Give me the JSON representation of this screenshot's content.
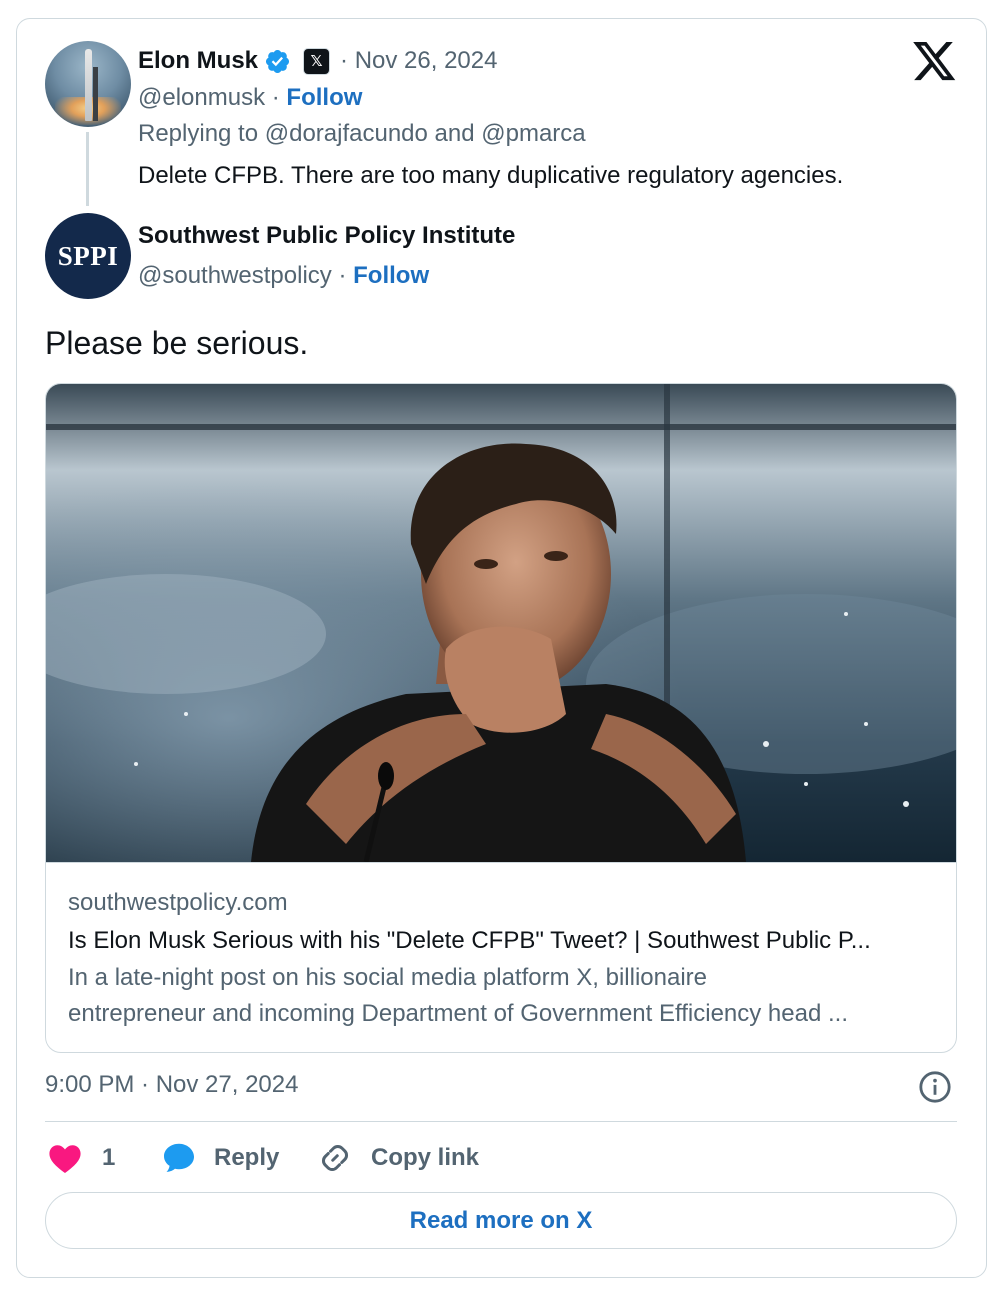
{
  "parent_tweet": {
    "author_name": "Elon Musk",
    "date": "Nov 26, 2024",
    "handle": "@elonmusk",
    "follow_label": "Follow",
    "replying_to": "Replying to @dorajfacundo and @pmarca",
    "text": "Delete CFPB. There are too many duplicative regulatory agencies.",
    "affiliate_badge": "𝕏"
  },
  "main_tweet": {
    "author_name": "Southwest Public Policy Institute",
    "avatar_text": "SPPI",
    "handle": "@southwestpolicy",
    "follow_label": "Follow",
    "text": "Please be serious.",
    "timestamp": "9:00 PM · Nov 27, 2024"
  },
  "link_card": {
    "domain": "southwestpolicy.com",
    "title": "Is Elon Musk Serious with his \"Delete CFPB\" Tweet? | Southwest Public P...",
    "description_line1": "In a late-night post on his social media platform X, billionaire",
    "description_line2": "entrepreneur and incoming Department of Government Efficiency head ..."
  },
  "actions": {
    "like_count": "1",
    "reply_label": "Reply",
    "copy_link_label": "Copy link"
  },
  "read_more_label": "Read more on X",
  "colors": {
    "link_blue": "#1d6fc0",
    "verified_blue": "#1d9bf0",
    "like_pink": "#f91880",
    "secondary_text": "#536471",
    "border": "#cfd9de",
    "sppi_navy": "#13294b"
  },
  "icons": {
    "logo": "x-logo-icon",
    "verified": "verified-badge-icon",
    "info": "info-icon",
    "like": "heart-icon",
    "reply": "speech-bubble-icon",
    "copy_link": "link-icon"
  }
}
